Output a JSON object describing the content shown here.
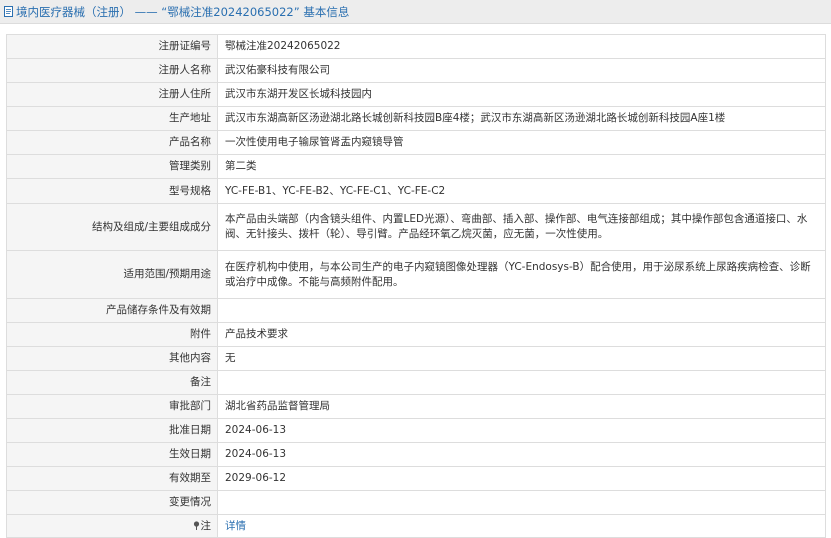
{
  "header": {
    "title": "境内医疗器械（注册） —— “鄂械注准20242065022” 基本信息"
  },
  "rows": [
    {
      "label": "注册证编号",
      "value": "鄂械注准20242065022"
    },
    {
      "label": "注册人名称",
      "value": "武汉佑豪科技有限公司"
    },
    {
      "label": "注册人住所",
      "value": "武汉市东湖开发区长城科技园内"
    },
    {
      "label": "生产地址",
      "value": "武汉市东湖高新区汤逊湖北路长城创新科技园B座4楼；武汉市东湖高新区汤逊湖北路长城创新科技园A座1楼"
    },
    {
      "label": "产品名称",
      "value": "一次性使用电子输尿管肾盂内窥镜导管"
    },
    {
      "label": "管理类别",
      "value": "第二类"
    },
    {
      "label": "型号规格",
      "value": "YC-FE-B1、YC-FE-B2、YC-FE-C1、YC-FE-C2"
    },
    {
      "label": "结构及组成/主要组成成分",
      "value": "本产品由头端部（内含镜头组件、内置LED光源）、弯曲部、插入部、操作部、电气连接部组成；其中操作部包含通道接口、水阀、无针接头、拨杆（轮）、导引臂。产品经环氧乙烷灭菌，应无菌，一次性使用。"
    },
    {
      "label": "适用范围/预期用途",
      "value": "在医疗机构中使用，与本公司生产的电子内窥镜图像处理器（YC-Endosys-B）配合使用，用于泌尿系统上尿路疾病检查、诊断或治疗中成像。不能与高频附件配用。"
    },
    {
      "label": "产品储存条件及有效期",
      "value": ""
    },
    {
      "label": "附件",
      "value": "产品技术要求"
    },
    {
      "label": "其他内容",
      "value": "无"
    },
    {
      "label": "备注",
      "value": ""
    },
    {
      "label": "审批部门",
      "value": "湖北省药品监督管理局"
    },
    {
      "label": "批准日期",
      "value": "2024-06-13"
    },
    {
      "label": "生效日期",
      "value": "2024-06-13"
    },
    {
      "label": "有效期至",
      "value": "2029-06-12"
    },
    {
      "label": "变更情况",
      "value": ""
    }
  ],
  "note": {
    "label": "注",
    "link_text": "详情",
    "icon": "pin-icon"
  },
  "colors": {
    "link": "#2a6fb0",
    "label_bg": "#f5f5f5",
    "border": "#dddddd"
  }
}
